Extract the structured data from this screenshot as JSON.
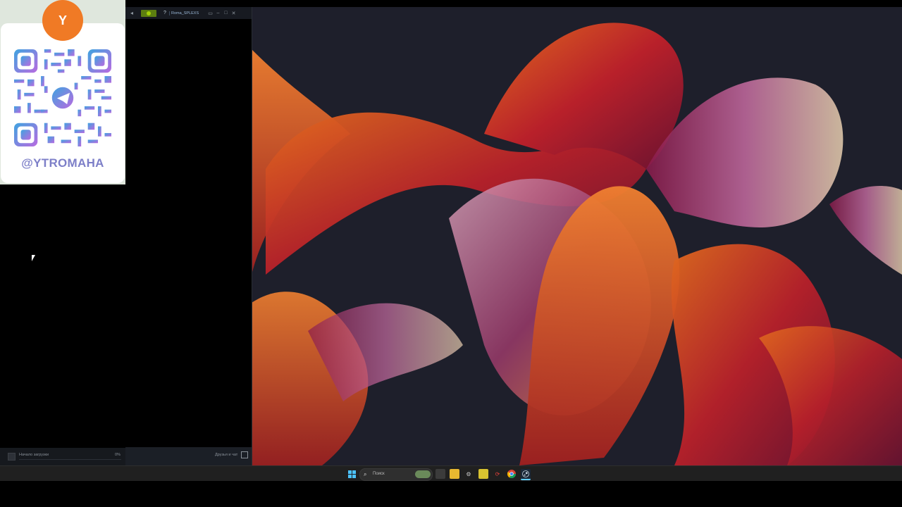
{
  "qr_card": {
    "avatar_letter": "Y",
    "handle": "@YTROMAHA"
  },
  "steam": {
    "username": "Roma_SPLEXS",
    "help": "?",
    "back_glyph": "◂",
    "win_controls": {
      "minimize": "–",
      "maximize": "□",
      "close": "✕",
      "screen": "▭"
    },
    "downloads": {
      "label": "Начало загрузки",
      "percent": "0%"
    },
    "friends_label": "Друзья и чат"
  },
  "taskbar": {
    "search_placeholder": "Поиск",
    "search_glyph": "🔍",
    "icons": [
      "windows-start-icon",
      "task-view-icon",
      "file-explorer-icon",
      "settings-icon",
      "sticky-notes-icon",
      "feedback-icon",
      "chrome-icon",
      "steam-icon"
    ]
  },
  "colors": {
    "accent_orange": "#f07a25",
    "handle_color": "#7d7fc8",
    "steam_green": "#5c7e10",
    "taskbar_bg": "#202020"
  }
}
